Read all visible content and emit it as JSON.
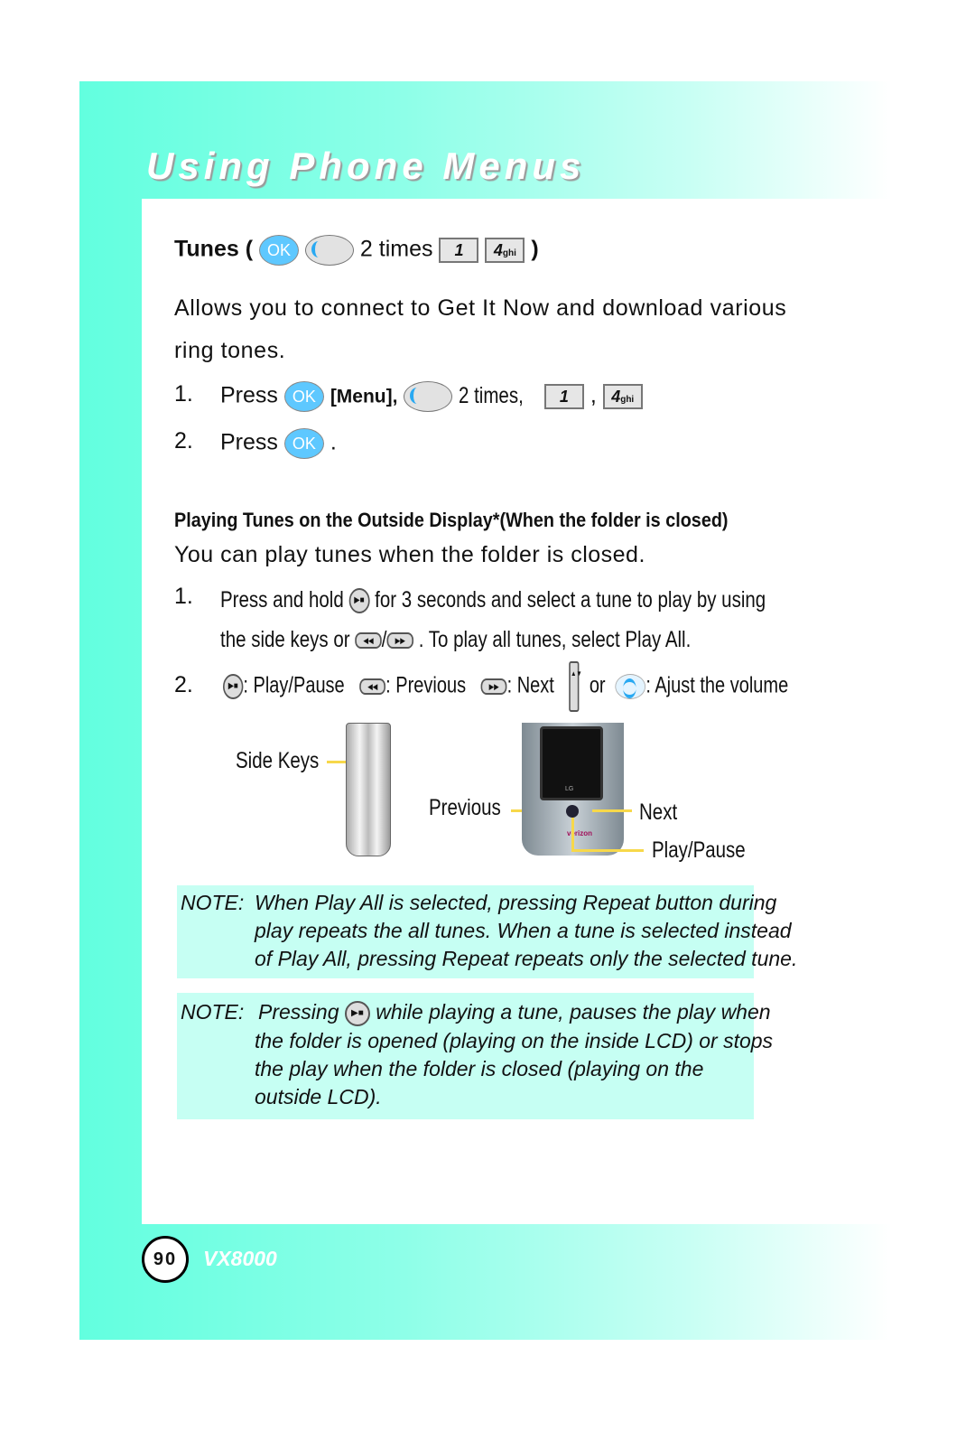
{
  "header": {
    "title": "Using Phone Menus"
  },
  "tunes": {
    "heading": "Tunes (",
    "ok": "OK",
    "times": "2 times",
    "key1": "1",
    "key4": "4",
    "key4_sub": "ghi",
    "close": ")"
  },
  "intro": {
    "line1": "Allows you to connect to Get It Now and download various",
    "line2": "ring tones."
  },
  "steps": [
    {
      "num": "1.",
      "press": "Press",
      "ok": "OK",
      "menu": "[Menu],",
      "times": "2 times,",
      "key1": "1",
      "comma": ",",
      "key4": "4",
      "key4_sub": "ghi"
    },
    {
      "num": "2.",
      "press": "Press",
      "ok": "OK",
      "end": "."
    }
  ],
  "outside": {
    "heading": "Playing Tunes on the Outside Display*(When the folder is closed)",
    "intro": "You can play tunes when the folder is closed.",
    "step1": {
      "num": "1.",
      "a": "Press and hold",
      "b": "for 3 seconds and select a tune to play by using",
      "c": "the side keys or",
      "slash": "/",
      "d": ". To play all tunes, select  Play All."
    },
    "step2": {
      "num": "2.",
      "play": ": Play/Pause",
      "prev": ": Previous",
      "next": ": Next",
      "or": "or",
      "vol": ": Ajust the volume"
    }
  },
  "figure": {
    "side_keys": "Side Keys",
    "previous": "Previous",
    "next": "Next",
    "play_pause": "Play/Pause",
    "lg": "LG",
    "brand": "verizon"
  },
  "notes": [
    {
      "label": "NOTE:",
      "lines": [
        "When Play All is selected, pressing Repeat button during",
        "play repeats the all tunes. When a tune is selected instead",
        "of Play All, pressing Repeat repeats only the selected tune."
      ]
    },
    {
      "label": "NOTE:",
      "lines": [
        "Pressing",
        "while playing a tune, pauses the play when",
        "the folder is opened (playing on the inside LCD) or stops",
        "the play when the folder is closed (playing on the",
        "outside LCD)."
      ]
    }
  ],
  "footer": {
    "page": "90",
    "model": "VX8000"
  },
  "colors": {
    "band": "#62ffdf",
    "ok": "#5ec8ff",
    "note_bg": "#c6fff3",
    "callout": "#f7d84a"
  }
}
